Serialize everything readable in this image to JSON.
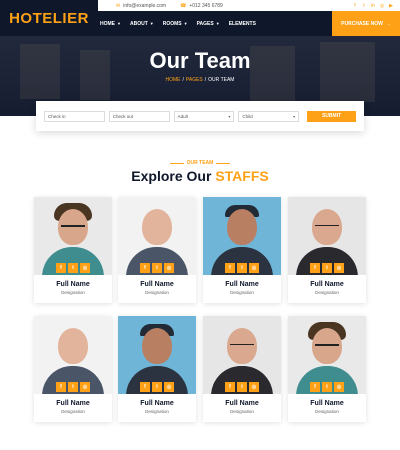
{
  "brand": "HOTELIER",
  "topbar": {
    "email": "info@example.com",
    "phone": "+012 345 6789",
    "social_icons": [
      "facebook-icon",
      "twitter-icon",
      "linkedin-icon",
      "instagram-icon",
      "youtube-icon"
    ]
  },
  "nav": {
    "items": [
      {
        "label": "HOME",
        "has_dropdown": true
      },
      {
        "label": "ABOUT",
        "has_dropdown": true
      },
      {
        "label": "ROOMS",
        "has_dropdown": true
      },
      {
        "label": "PAGES",
        "has_dropdown": true
      },
      {
        "label": "ELEMENTS",
        "has_dropdown": false
      }
    ],
    "cta": "PURCHASE NOW"
  },
  "hero": {
    "title": "Our Team",
    "breadcrumb": {
      "home": "HOME",
      "pages": "PAGES",
      "current": "OUR TEAM"
    }
  },
  "booking": {
    "checkin_placeholder": "Check in",
    "checkout_placeholder": "Check out",
    "adult_value": "Adult",
    "child_value": "Child",
    "submit_label": "SUBMIT"
  },
  "team_section": {
    "eyebrow": "OUR TEAM",
    "title_prefix": "Explore Our",
    "title_accent": "STAFFS"
  },
  "team": [
    {
      "name": "Full Name",
      "role": "Designation"
    },
    {
      "name": "Full Name",
      "role": "Designation"
    },
    {
      "name": "Full Name",
      "role": "Designation"
    },
    {
      "name": "Full Name",
      "role": "Designation"
    },
    {
      "name": "Full Name",
      "role": "Designation"
    },
    {
      "name": "Full Name",
      "role": "Designation"
    },
    {
      "name": "Full Name",
      "role": "Designation"
    },
    {
      "name": "Full Name",
      "role": "Designation"
    }
  ],
  "colors": {
    "accent": "#fea116",
    "dark": "#0f172b"
  }
}
